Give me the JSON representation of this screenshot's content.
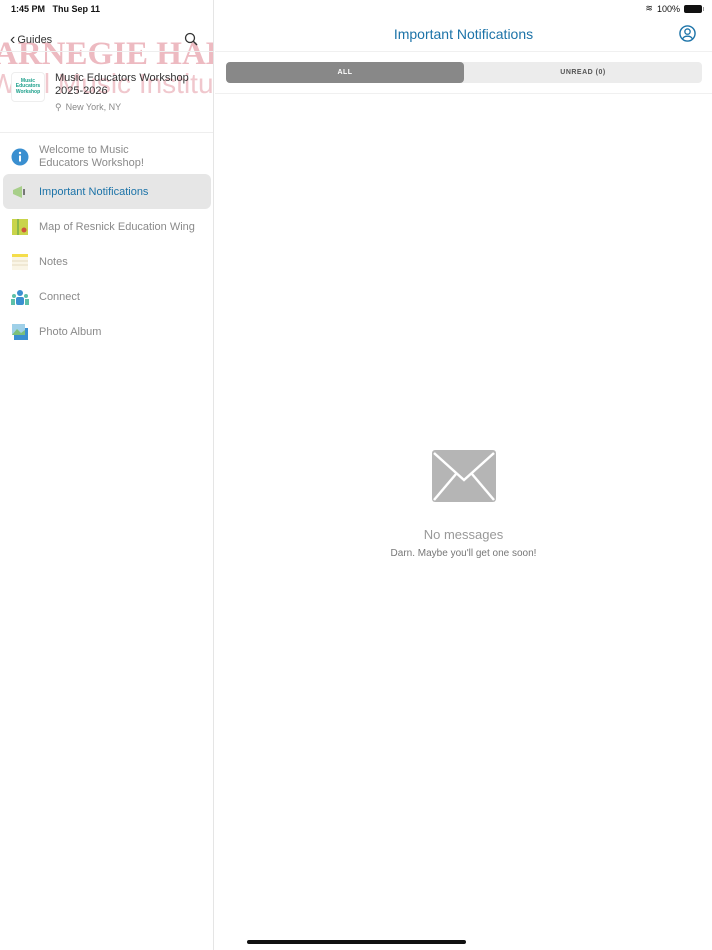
{
  "status": {
    "time": "1:45 PM",
    "date": "Thu Sep 11",
    "battery": "100%"
  },
  "sidebar": {
    "back_label": "Guides",
    "watermark_line1": "CARNEGIE HALL",
    "watermark_line2": "Weill Music Institute",
    "guide": {
      "logo_text": "Music Educators Workshop",
      "title": "Music Educators Workshop 2025-2026",
      "location": "New York, NY"
    },
    "items": [
      {
        "label": "Welcome to Music Educators Workshop!",
        "icon": "info-icon"
      },
      {
        "label": "Important Notifications",
        "icon": "megaphone-icon",
        "active": true
      },
      {
        "label": "Map of Resnick Education Wing",
        "icon": "map-icon"
      },
      {
        "label": "Notes",
        "icon": "notes-icon"
      },
      {
        "label": "Connect",
        "icon": "people-icon"
      },
      {
        "label": "Photo Album",
        "icon": "photo-icon"
      }
    ]
  },
  "main": {
    "title": "Important Notifications",
    "tabs": [
      {
        "label": "ALL",
        "selected": true
      },
      {
        "label": "UNREAD (0)",
        "selected": false
      }
    ],
    "empty": {
      "title": "No messages",
      "subtitle": "Darn. Maybe you'll get one soon!"
    }
  },
  "colors": {
    "accent": "#1c73a8",
    "watermark": "#e8a3ad"
  }
}
